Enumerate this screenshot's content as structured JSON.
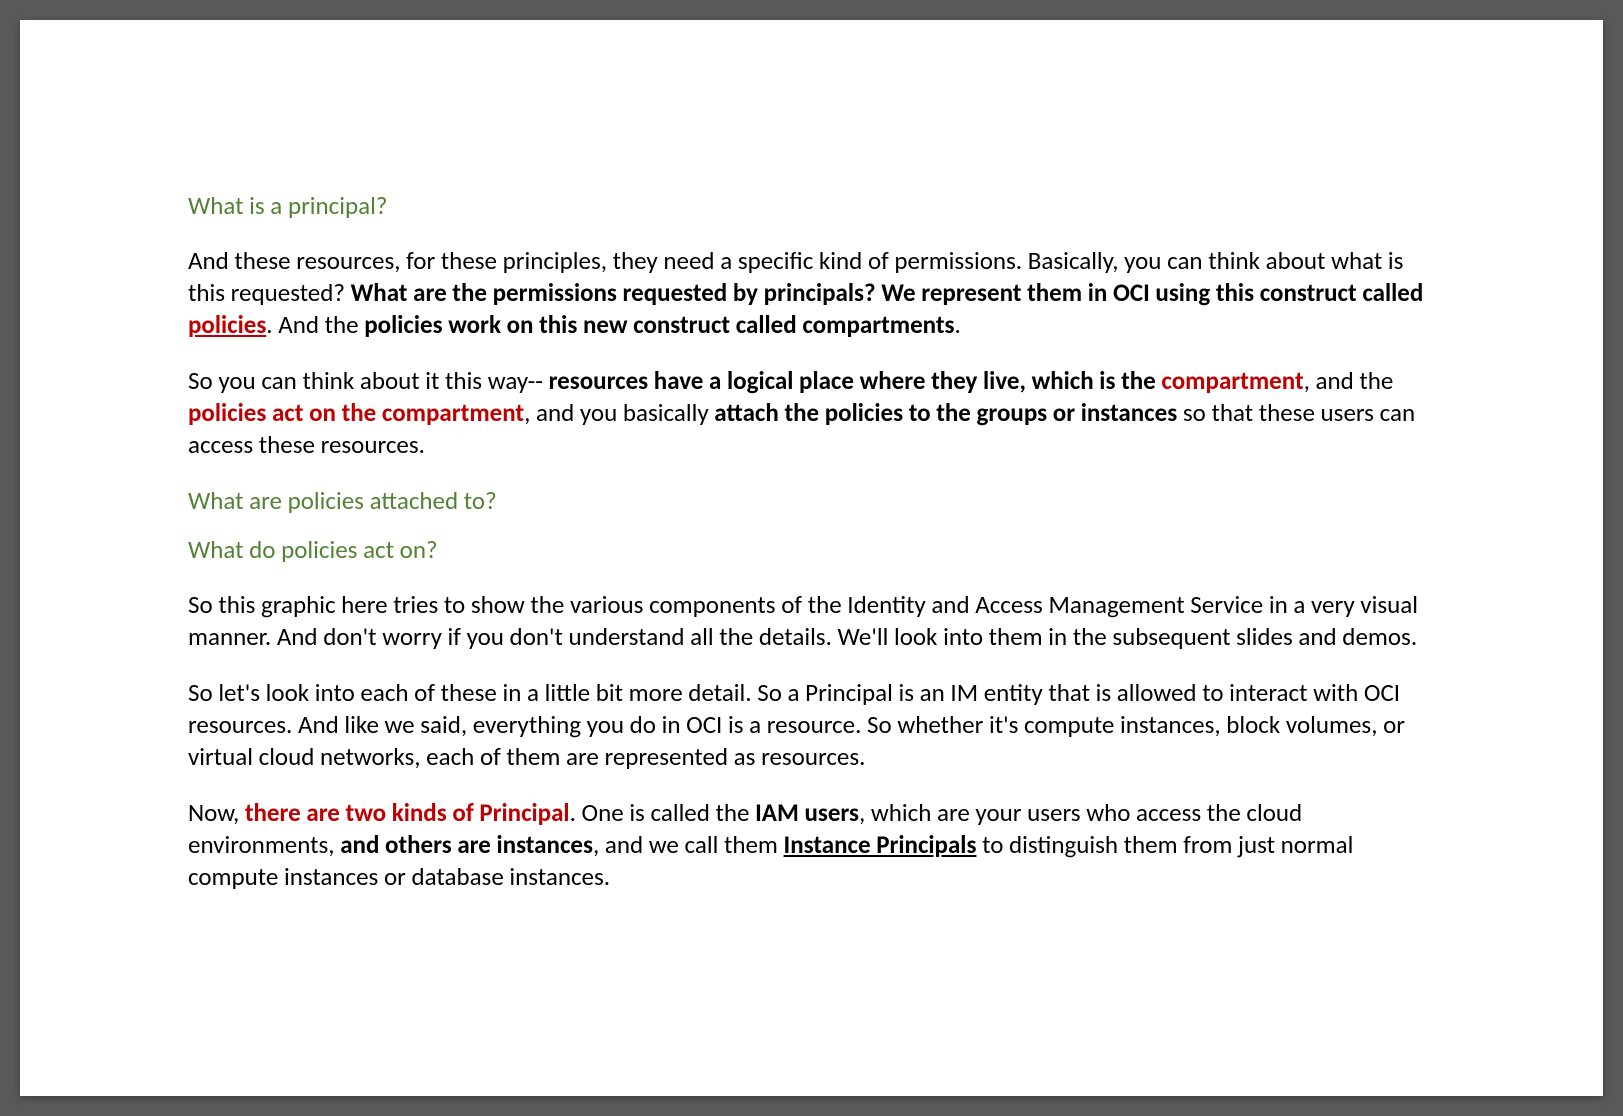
{
  "headings": {
    "h1": "What is a principal?",
    "h2": "What are policies attached to?",
    "h3": "What do policies act on?"
  },
  "p1": {
    "t1": "And these resources, for these principles, they need a specific kind of permissions. Basically, you can think about what is this requested? ",
    "t2": "What are the permissions requested by principals? We represent them in OCI using this construct called ",
    "t3": "policies",
    "t4": ". And the ",
    "t5": "policies work on this new construct called compartments",
    "t6": "."
  },
  "p2": {
    "t1": "So you can think about it this way-- ",
    "t2": "resources have a logical place where they live, which is the ",
    "t3": "compartment",
    "t4": ", and the ",
    "t5": "policies act on the compartment",
    "t6": ", and you basically ",
    "t7": "attach the policies to the groups or instances",
    "t8": " so that these users can access these resources."
  },
  "p3": {
    "t1": "So this graphic here tries to show the various components of the Identity and Access Management Service in a very visual manner. And don't worry if you don't understand all the details. We'll look into them in the subsequent slides and demos."
  },
  "p4": {
    "t1": "So let's look into each of these in a little bit more detail. So a Principal is an IM entity that is allowed to interact with OCI resources. And like we said, everything you do in OCI is a resource. So whether it's compute instances, block volumes, or virtual cloud networks, each of them are represented as resources."
  },
  "p5": {
    "t1": "Now, ",
    "t2": "there are two kinds of Principal",
    "t3": ". One is called the ",
    "t4": "IAM users",
    "t5": ", which are your users who access the cloud environments, ",
    "t6": "and others are instances",
    "t7": ", and we call them ",
    "t8": "Instance Principals",
    "t9": " to distinguish them from just normal compute instances or database instances."
  }
}
